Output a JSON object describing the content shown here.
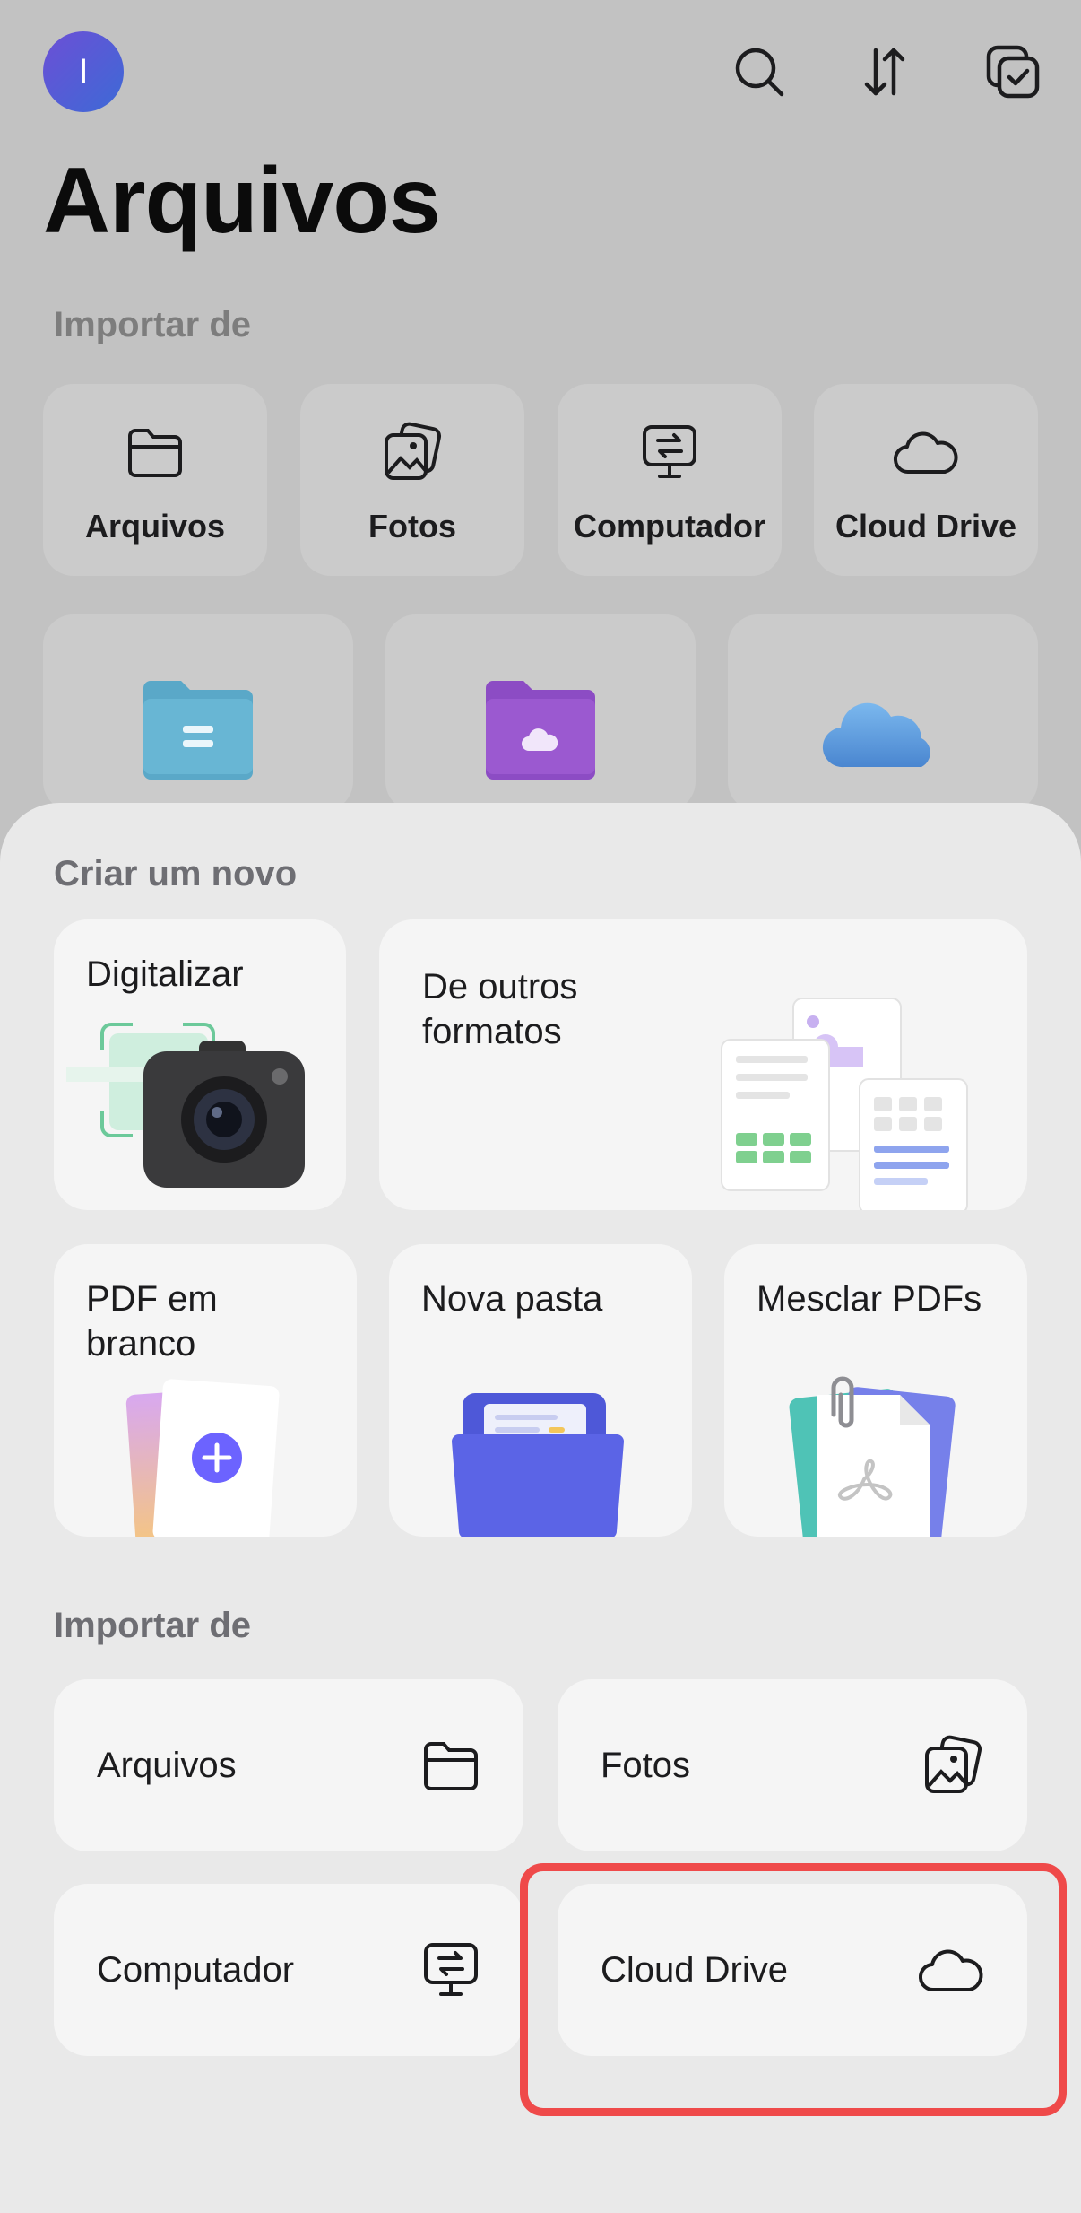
{
  "header": {
    "avatar_letter": "I",
    "title": "Arquivos",
    "icons": [
      "search-icon",
      "sort-icon",
      "select-icon"
    ]
  },
  "import_top": {
    "title": "Importar de",
    "items": [
      {
        "label": "Arquivos",
        "icon": "folder-icon"
      },
      {
        "label": "Fotos",
        "icon": "photos-icon"
      },
      {
        "label": "Computador",
        "icon": "computer-transfer-icon"
      },
      {
        "label": "Cloud Drive",
        "icon": "cloud-icon"
      }
    ]
  },
  "locations": [
    {
      "icon": "blue-folder-icon",
      "color": "#5aa8c8"
    },
    {
      "icon": "purple-cloud-folder-icon",
      "color": "#9b59d0"
    },
    {
      "icon": "icloud-icon",
      "color": "#6aa9e8"
    }
  ],
  "create": {
    "title": "Criar um novo",
    "scan": "Digitalizar",
    "other_formats": "De outros formatos",
    "blank_pdf": "PDF em branco",
    "new_folder": "Nova pasta",
    "merge": "Mesclar PDFs"
  },
  "import_bottom": {
    "title": "Importar de",
    "files": "Arquivos",
    "photos": "Fotos",
    "computer": "Computador",
    "cloud": "Cloud Drive"
  },
  "colors": {
    "highlight": "#ef4a4a",
    "accent": "#6c63ff"
  }
}
